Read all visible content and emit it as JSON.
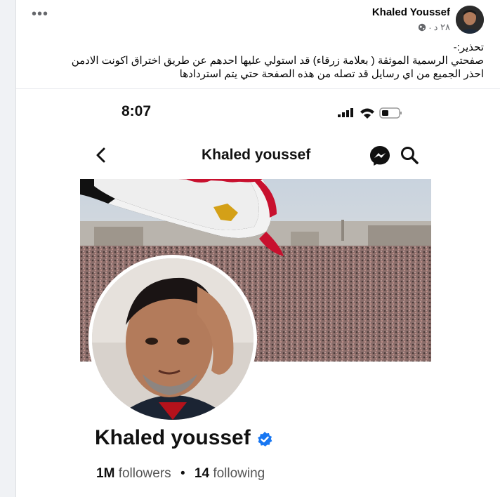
{
  "post": {
    "author": "Khaled Youssef",
    "time": "٢٨ د",
    "separator": "·",
    "privacy_icon": "globe-icon",
    "more_icon": "more-options-icon",
    "text_lines": [
      "تحذير:-",
      "صفحتي الرسمية الموثقة ( بعلامة زرقاء)  قد استولي عليها احدهم عن طريق اختراق اكونت الادمن",
      "احذر الجميع من اي رسايل قد تصله من هذه الصفحة حتي يتم استردادها"
    ]
  },
  "screenshot": {
    "time": "8:07",
    "nav_title": "Khaled youssef",
    "back_icon": "chevron-left-icon",
    "messenger_icon": "messenger-icon",
    "search_icon": "search-icon",
    "profile_name": "Khaled youssef",
    "verified_icon": "verified-badge-icon",
    "followers_count": "1M",
    "followers_label": "followers",
    "following_count": "14",
    "following_label": "following",
    "dot": "•"
  },
  "colors": {
    "verified": "#1877f2",
    "flag_red": "#c8102e",
    "flag_black": "#111111",
    "eagle_gold": "#d4a017"
  }
}
